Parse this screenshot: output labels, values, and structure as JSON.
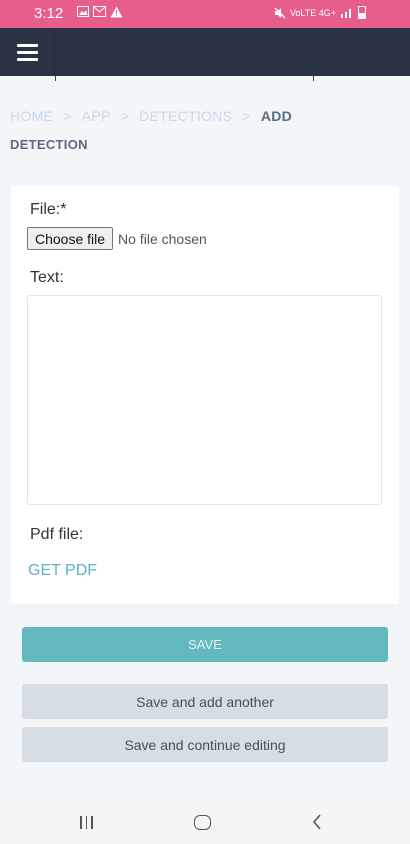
{
  "status_bar": {
    "time": "3:12",
    "left_icons": [
      "gallery-icon",
      "mail-icon",
      "warning-icon"
    ],
    "right_icons": [
      "mute-icon",
      "volte-icon",
      "signal-icon",
      "battery-icon"
    ],
    "network_label": "VoLTE 4G+"
  },
  "header": {
    "menu_icon": "hamburger-menu-icon"
  },
  "breadcrumb": {
    "items": [
      "Home",
      "App",
      "Detections"
    ],
    "separator": ">",
    "current_line1": "Add",
    "current_line2": "Detection"
  },
  "form": {
    "file_label": "File:*",
    "choose_button": "Choose file",
    "file_status": "No file chosen",
    "text_label": "Text:",
    "text_value": "",
    "pdf_label": "Pdf file:",
    "pdf_link": "GET PDF"
  },
  "actions": {
    "save": "SAVE",
    "save_add_another": "Save and add another",
    "save_continue": "Save and continue editing"
  },
  "nav_bar": {
    "recents_icon": "recents-icon",
    "home_icon": "home-icon",
    "back_icon": "back-icon"
  },
  "colors": {
    "status_bar": "#e75d8e",
    "header": "#2a3343",
    "accent": "#64b9be",
    "link": "#5ab4be",
    "secondary_button": "#d5dde5"
  }
}
